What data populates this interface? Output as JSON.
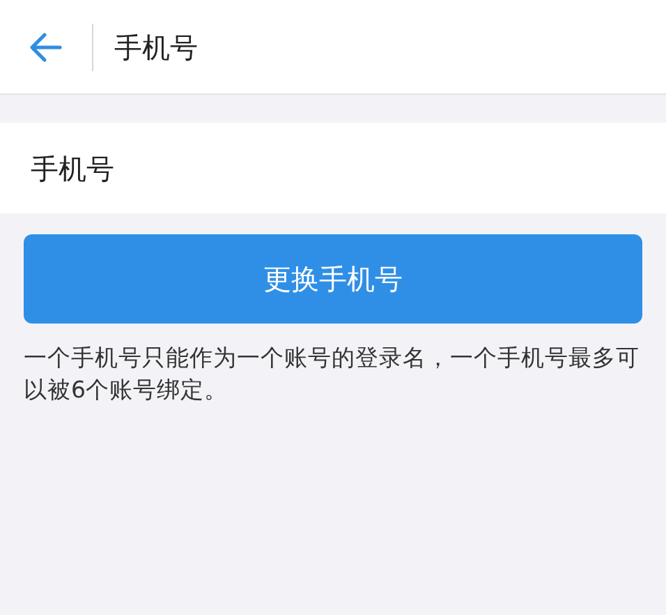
{
  "header": {
    "title": "手机号"
  },
  "field": {
    "label": "手机号"
  },
  "button": {
    "label": "更换手机号"
  },
  "note": "一个手机号只能作为一个账号的登录名，一个手机号最多可以被6个账号绑定。"
}
